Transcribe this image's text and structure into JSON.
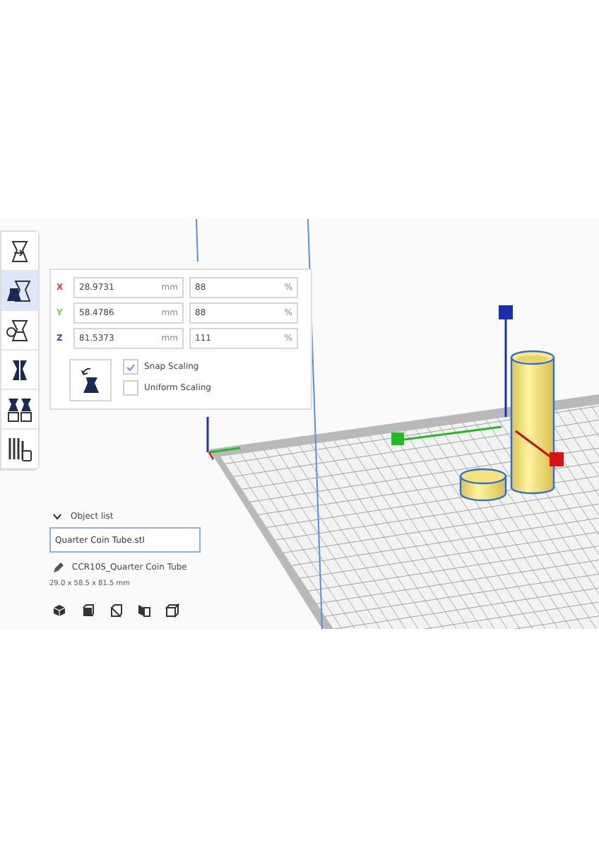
{
  "toolbar": [
    {
      "selected": false
    },
    {
      "selected": true
    },
    {
      "selected": false
    },
    {
      "selected": false
    },
    {
      "selected": false
    },
    {
      "selected": false
    }
  ],
  "scale_panel": {
    "rows": [
      {
        "axis": "X",
        "color": "#e53935",
        "size": "28.9731",
        "size_unit": "mm",
        "percent": "88",
        "percent_unit": "%"
      },
      {
        "axis": "Y",
        "color": "#7cc94a",
        "size": "58.4786",
        "size_unit": "mm",
        "percent": "88",
        "percent_unit": "%"
      },
      {
        "axis": "Z",
        "color": "#3949ab",
        "size": "81.5373",
        "size_unit": "mm",
        "percent": "111",
        "percent_unit": "%"
      }
    ],
    "options": [
      {
        "label": "Snap Scaling",
        "checked": true
      },
      {
        "label": "Uniform Scaling",
        "checked": false
      }
    ]
  },
  "object_list": {
    "title": "Object list",
    "expanded": true,
    "selected_file": "Quarter Coin Tube.stl",
    "object_name": "CCR10S_Quarter Coin Tube",
    "dimensions": "29.0 x 58.5 x 81.5 mm"
  }
}
